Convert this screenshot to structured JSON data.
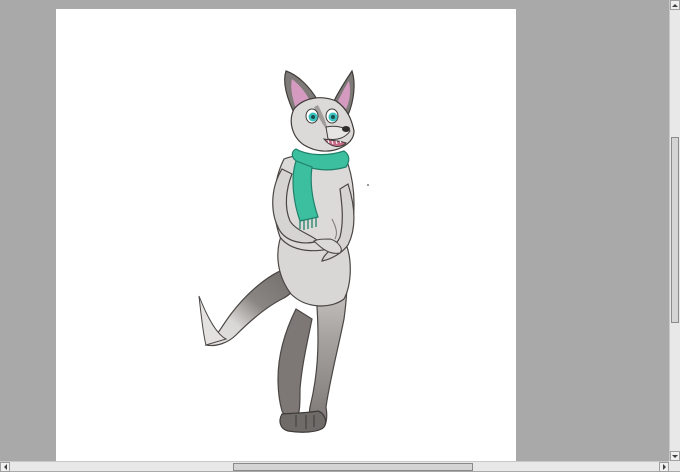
{
  "canvas": {
    "background": "#ffffff",
    "artwork": "wolf-character-with-teal-scarf-icon"
  },
  "workspace": {
    "background": "#a9a9a9"
  },
  "colors": {
    "fur_light": "#d8d6d4",
    "fur_dark": "#7b7673",
    "scarf": "#3bbf9f",
    "eye": "#38c3c0",
    "ear_inner": "#d49ac0"
  },
  "scrollbars": {
    "vertical": {
      "up_icon": "arrow-up-icon",
      "down_icon": "arrow-down-icon"
    },
    "horizontal": {
      "left_icon": "arrow-left-icon",
      "right_icon": "arrow-right-icon"
    }
  }
}
